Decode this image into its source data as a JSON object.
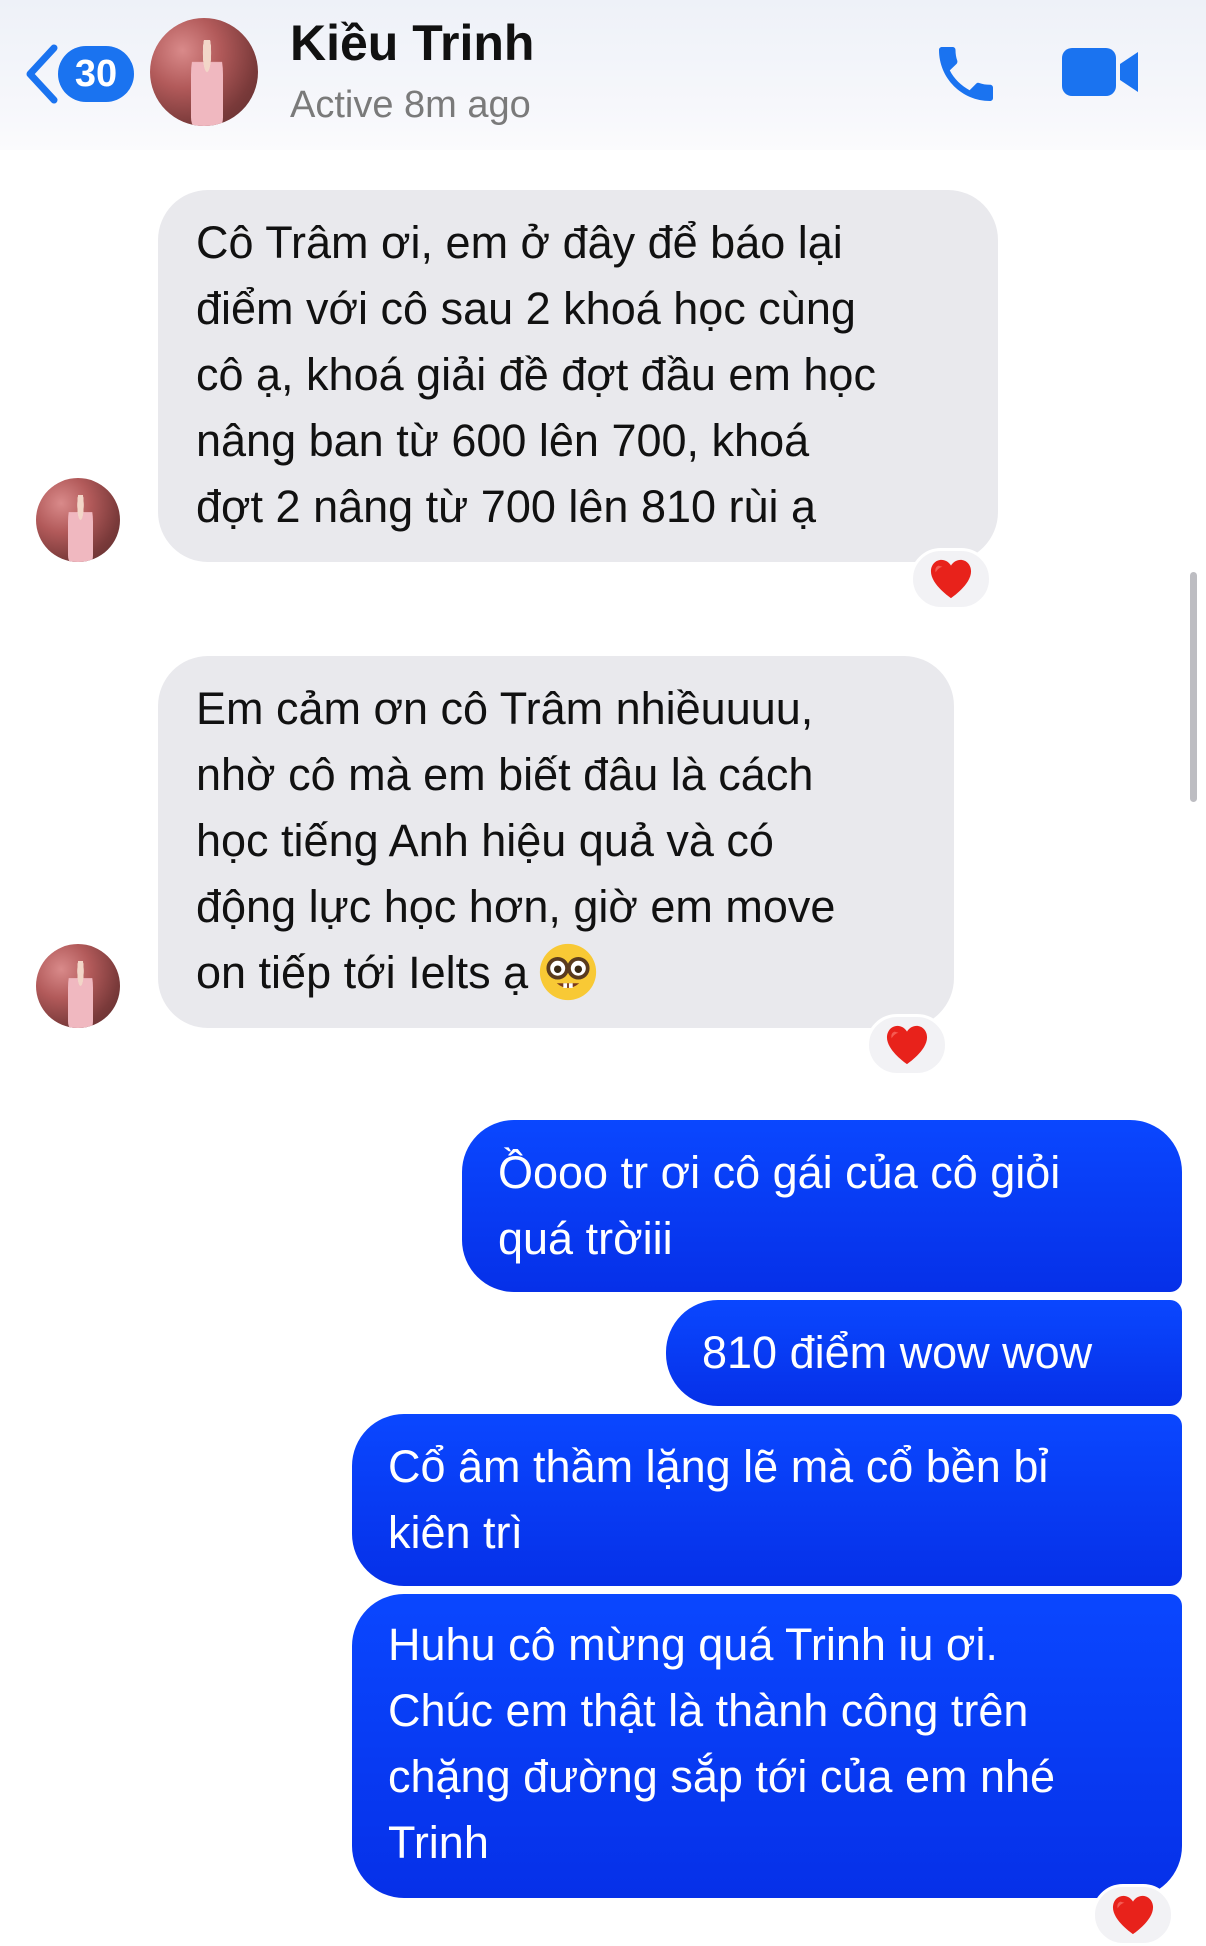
{
  "header": {
    "back_count": "30",
    "contact_name": "Kiều Trinh",
    "status": "Active 8m ago"
  },
  "icons": {
    "back": "chevron-left-icon",
    "phone": "phone-icon",
    "video": "video-camera-icon",
    "reaction": "heart",
    "emoji": "nerd-face"
  },
  "colors": {
    "accent": "#1a73f0",
    "outgoing_bubble": "#0a3cf5",
    "incoming_bubble": "#e9e9ed",
    "heart": "#e8221b"
  },
  "messages": [
    {
      "direction": "incoming",
      "lines": [
        "Cô Trâm ơi, em ở đây để báo lại",
        "điểm với cô sau 2 khoá học cùng",
        "cô ạ, khoá giải đề đợt đầu em học",
        "nâng ban từ 600 lên 700, khoá",
        "đợt 2 nâng từ 700 lên 810 rùi ạ"
      ],
      "reaction": "❤️"
    },
    {
      "direction": "incoming",
      "lines": [
        "Em cảm ơn cô Trâm nhiềuuuu,",
        "nhờ cô mà em biết đâu là cách",
        "học tiếng Anh hiệu quả và có",
        "động lực học hơn, giờ em move",
        "on tiếp tới Ielts ạ"
      ],
      "reaction": "❤️"
    },
    {
      "direction": "outgoing",
      "lines": [
        "Ồooo tr ơi cô gái của cô giỏi",
        "quá trờiii"
      ]
    },
    {
      "direction": "outgoing",
      "lines": [
        "810 điểm wow wow"
      ]
    },
    {
      "direction": "outgoing",
      "lines": [
        "Cổ âm thầm lặng lẽ mà cổ bền bỉ",
        "kiên trì"
      ]
    },
    {
      "direction": "outgoing",
      "lines": [
        "Huhu cô mừng quá Trinh iu ơi.",
        "Chúc em thật là thành công trên",
        "chặng đường sắp tới của em nhé",
        "Trinh"
      ],
      "reaction": "❤️"
    }
  ]
}
